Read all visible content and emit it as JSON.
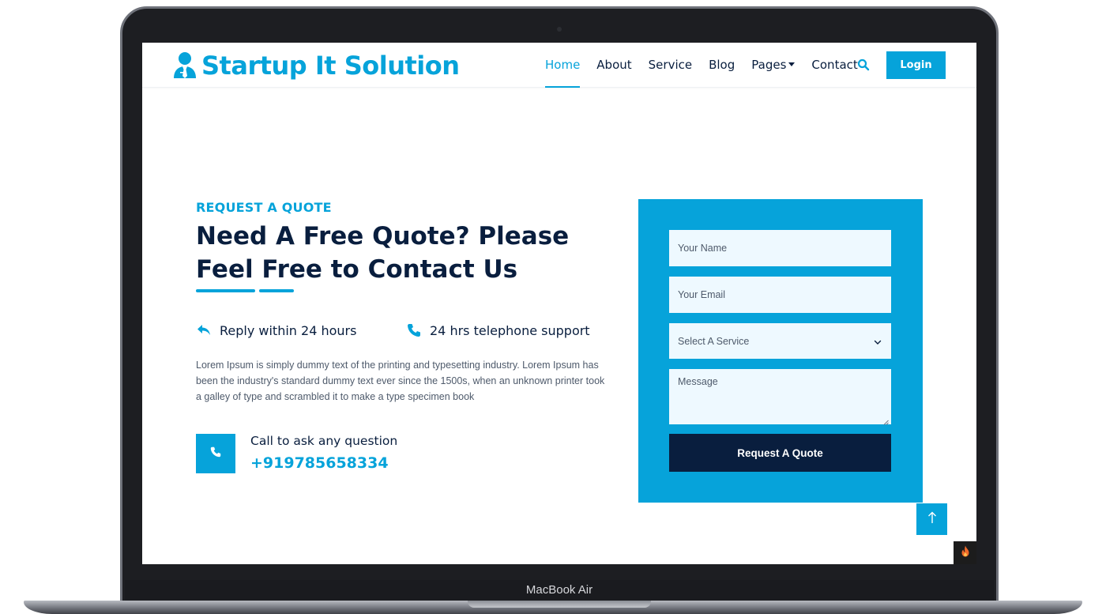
{
  "device": {
    "label": "MacBook Air"
  },
  "navbar": {
    "brand": "Startup It Solution",
    "links": [
      "Home",
      "About",
      "Service",
      "Blog",
      "Pages",
      "Contact"
    ],
    "active": "Home",
    "login_label": "Login"
  },
  "hero": {
    "eyebrow": "REQUEST A QUOTE",
    "headline": "Need A Free Quote? Please Feel Free to Contact Us",
    "features": [
      "Reply within 24 hours",
      "24 hrs telephone support"
    ],
    "description": "Lorem Ipsum is simply dummy text of the printing and typesetting industry. Lorem Ipsum has been the industry's standard dummy text ever since the 1500s, when an unknown printer took a galley of type and scrambled it to make a type specimen book",
    "call_label": "Call to ask any question",
    "call_number": "+919785658334"
  },
  "form": {
    "name_placeholder": "Your Name",
    "email_placeholder": "Your Email",
    "service_selected": "Select A Service",
    "message_placeholder": "Message",
    "submit_label": "Request A Quote"
  },
  "colors": {
    "primary": "#06a3da",
    "dark": "#091e3e",
    "field_bg": "#eef9ff"
  },
  "icons": [
    "user-tie-icon",
    "search-icon",
    "reply-icon",
    "phone-icon",
    "arrow-up-icon",
    "fire-icon",
    "chevron-down-icon"
  ]
}
